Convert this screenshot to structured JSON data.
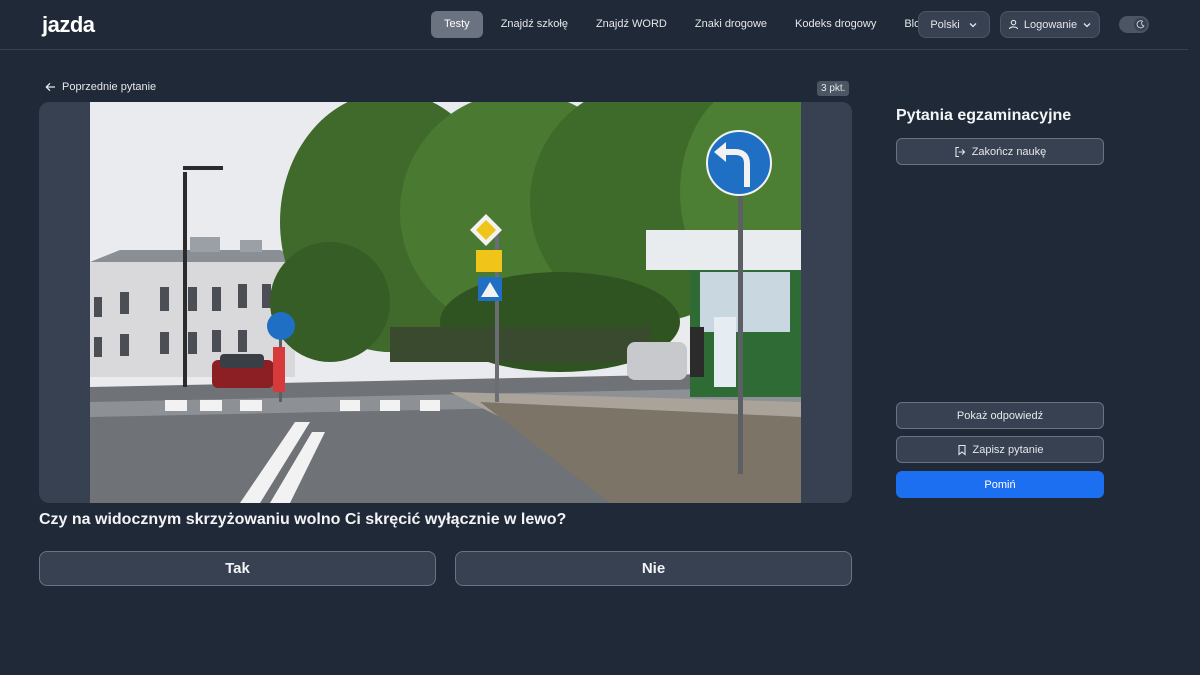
{
  "header": {
    "logo": "jazda",
    "nav": [
      "Testy",
      "Znajdź szkołę",
      "Znajdź WORD",
      "Znaki drogowe",
      "Kodeks drogowy",
      "Blog"
    ],
    "active_nav": "Testy",
    "language": "Polski",
    "login": "Logowanie"
  },
  "main": {
    "prev_label": "Poprzednie pytanie",
    "points": "3 pkt.",
    "question": "Czy na widocznym skrzyżowaniu wolno Ci skręcić wyłącznie w lewo?",
    "answers": [
      "Tak",
      "Nie"
    ]
  },
  "sidebar": {
    "title": "Pytania egzaminacyjne",
    "end_label": "Zakończ naukę",
    "show_label": "Pokaż odpowiedź",
    "save_label": "Zapisz pytanie",
    "skip_label": "Pomiń"
  },
  "colors": {
    "background": "#1f2937",
    "panel": "#374151",
    "accent": "#1d6ff2"
  }
}
